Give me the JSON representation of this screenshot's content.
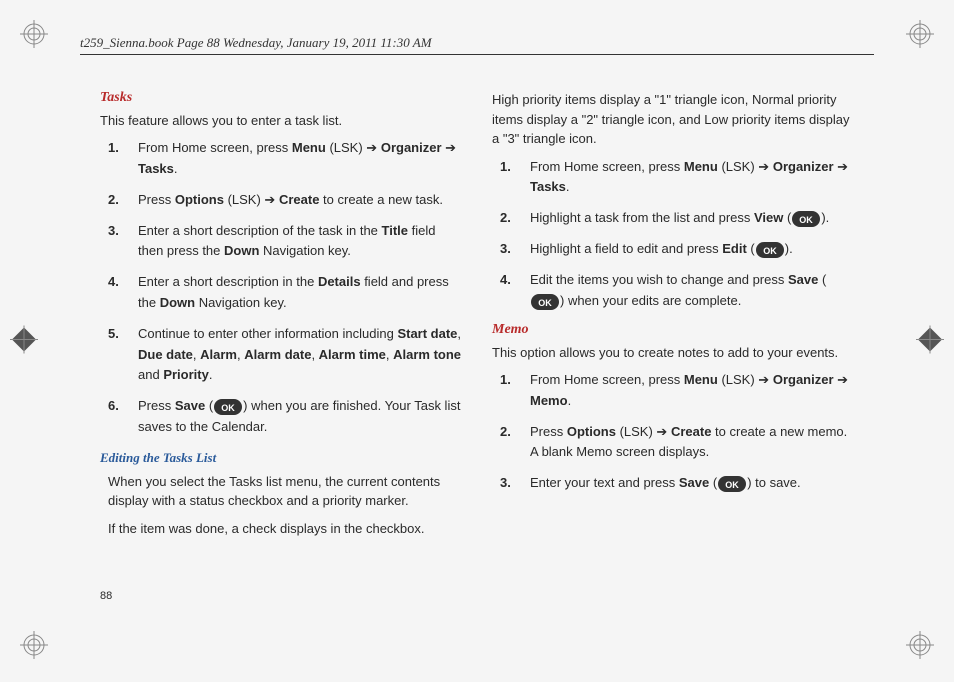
{
  "header": "t259_Sienna.book  Page 88  Wednesday, January 19, 2011  11:30 AM",
  "page_number": "88",
  "arrow": "➔",
  "col1": {
    "tasks_title": "Tasks",
    "tasks_intro": "This feature allows you to enter a task list.",
    "step1_a": "From Home screen, press ",
    "step1_b": "Menu",
    "step1_c": " (LSK) ",
    "step1_d": "Organizer",
    "step1_e": "Tasks",
    "step1_f": ".",
    "step2_a": "Press ",
    "step2_b": "Options",
    "step2_c": " (LSK) ",
    "step2_d": "Create",
    "step2_e": " to create a new task.",
    "step3_a": "Enter a short description of the task in the ",
    "step3_b": "Title",
    "step3_c": " field then press the ",
    "step3_d": "Down",
    "step3_e": " Navigation key.",
    "step4_a": "Enter a short description in the ",
    "step4_b": "Details",
    "step4_c": " field and press the ",
    "step4_d": "Down",
    "step4_e": " Navigation key.",
    "step5_a": "Continue to enter other information including ",
    "step5_b": "Start date",
    "step5_c": ", ",
    "step5_d": "Due date",
    "step5_e": ", ",
    "step5_f": "Alarm",
    "step5_g": ", ",
    "step5_h": "Alarm date",
    "step5_i": ", ",
    "step5_j": "Alarm time",
    "step5_k": ", ",
    "step5_l": "Alarm tone",
    "step5_m": " and ",
    "step5_n": "Priority",
    "step5_o": ".",
    "step6_a": "Press ",
    "step6_b": "Save",
    "step6_c": " (",
    "step6_d": ") when you are finished. Your Task list saves to the Calendar.",
    "edit_title": "Editing the Tasks List",
    "edit_p1": "When you select the Tasks list menu, the current contents display with a status checkbox and a priority marker.",
    "edit_p2": "If the item was done, a check displays in the checkbox."
  },
  "col2": {
    "priority_info": "High priority items display a \"1\" triangle icon, Normal priority items display a \"2\" triangle icon, and Low priority items display a \"3\" triangle icon.",
    "r1_a": "From Home screen, press ",
    "r1_b": "Menu",
    "r1_c": " (LSK) ",
    "r1_d": "Organizer",
    "r1_e": "Tasks",
    "r1_f": ".",
    "r2_a": "Highlight a task from the list and press ",
    "r2_b": "View",
    "r2_c": " (",
    "r2_d": ").",
    "r3_a": "Highlight a field to edit and press ",
    "r3_b": "Edit",
    "r3_c": " (",
    "r3_d": ").",
    "r4_a": "Edit the items you wish to change and press ",
    "r4_b": "Save",
    "r4_c": " (",
    "r4_d": ") when your edits are complete.",
    "memo_title": "Memo",
    "memo_intro": "This option allows you to create notes to add to your events.",
    "m1_a": "From Home screen, press ",
    "m1_b": "Menu",
    "m1_c": " (LSK) ",
    "m1_d": "Organizer",
    "m1_e": "Memo",
    "m1_f": ".",
    "m2_a": "Press ",
    "m2_b": "Options",
    "m2_c": " (LSK) ",
    "m2_d": "Create",
    "m2_e": " to create a new memo. A blank Memo screen displays.",
    "m3_a": "Enter your text and press ",
    "m3_b": "Save",
    "m3_c": " (",
    "m3_d": ") to save."
  }
}
